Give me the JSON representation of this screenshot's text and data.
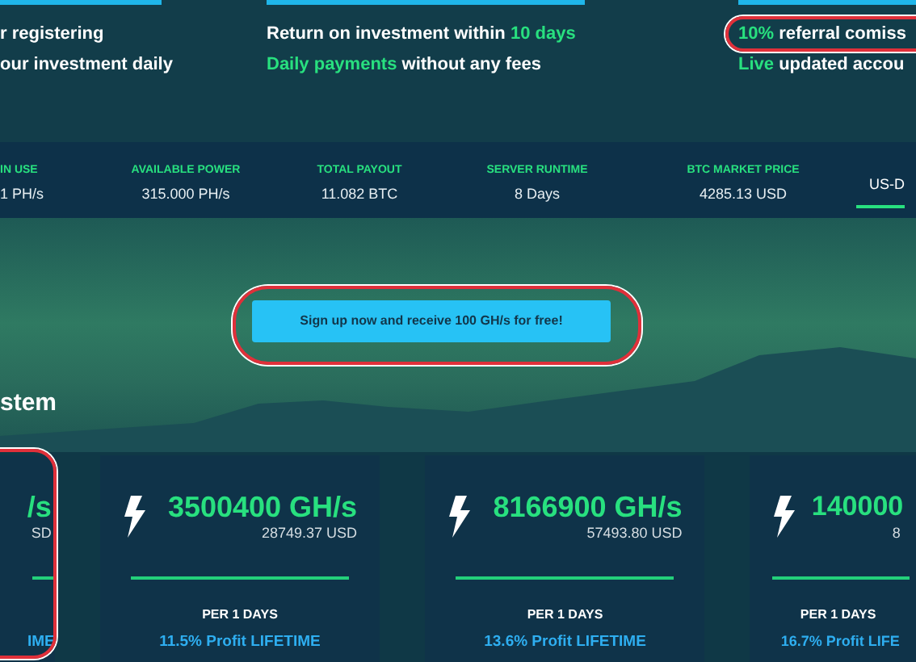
{
  "features": [
    {
      "lines": [
        [
          {
            "text": "r registering",
            "highlight": false
          }
        ],
        [
          {
            "text": "our investment daily",
            "highlight": false
          }
        ]
      ]
    },
    {
      "lines": [
        [
          {
            "text": "Return on investment within ",
            "highlight": false
          },
          {
            "text": "10 days",
            "highlight": true
          }
        ],
        [
          {
            "text": "Daily payments",
            "highlight": true
          },
          {
            "text": " without any fees",
            "highlight": false
          }
        ]
      ]
    },
    {
      "lines": [
        [
          {
            "text": "10%",
            "highlight": true
          },
          {
            "text": " referral comiss",
            "highlight": false
          }
        ],
        [
          {
            "text": "Live",
            "highlight": true
          },
          {
            "text": " updated accou",
            "highlight": false
          }
        ]
      ]
    }
  ],
  "stats": [
    {
      "label": "IN USE",
      "value": "1 PH/s"
    },
    {
      "label": "AVAILABLE POWER",
      "value": "315.000 PH/s"
    },
    {
      "label": "TOTAL PAYOUT",
      "value": "11.082 BTC"
    },
    {
      "label": "SERVER RUNTIME",
      "value": "8 Days"
    },
    {
      "label": "BTC MARKET PRICE",
      "value": "4285.13 USD"
    }
  ],
  "currency_tab": {
    "label": "US-D",
    "selected": true
  },
  "signup_button": "Sign up now and receive 100 GH/s for free!",
  "heading": "stem",
  "plans": [
    {
      "kind": "partial",
      "power": "/s",
      "price": "SD",
      "profit": "IME"
    },
    {
      "kind": "full",
      "power": "3500400 GH/s",
      "price": "28749.37 USD",
      "period": "PER 1 DAYS",
      "profit": "11.5% Profit LIFETIME"
    },
    {
      "kind": "full",
      "power": "8166900 GH/s",
      "price": "57493.80 USD",
      "period": "PER 1 DAYS",
      "profit": "13.6% Profit LIFETIME"
    },
    {
      "kind": "full",
      "power": "140000",
      "price": "8",
      "period": "PER 1 DAYS",
      "profit": "16.7% Profit LIFE"
    }
  ]
}
